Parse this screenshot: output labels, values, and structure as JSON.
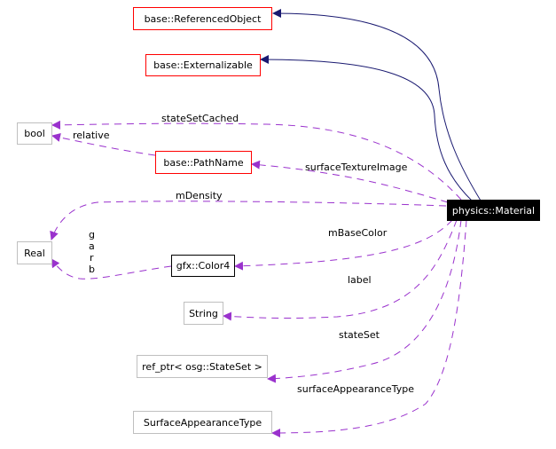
{
  "diagram": {
    "focus_class": "physics::Material",
    "nodes": [
      {
        "id": "referenced-object",
        "label": "base::ReferencedObject",
        "style": "red"
      },
      {
        "id": "externalizable",
        "label": "base::Externalizable",
        "style": "red"
      },
      {
        "id": "bool",
        "label": "bool",
        "style": "gray"
      },
      {
        "id": "pathname",
        "label": "base::PathName",
        "style": "red"
      },
      {
        "id": "material",
        "label": "physics::Material",
        "style": "focus"
      },
      {
        "id": "real",
        "label": "Real",
        "style": "gray"
      },
      {
        "id": "color4",
        "label": "gfx::Color4",
        "style": "black"
      },
      {
        "id": "string",
        "label": "String",
        "style": "gray"
      },
      {
        "id": "stateset-ptr",
        "label": "ref_ptr< osg::StateSet >",
        "style": "gray"
      },
      {
        "id": "surface-appearance-type",
        "label": "SurfaceAppearanceType",
        "style": "gray"
      }
    ],
    "edges": [
      {
        "from": "material",
        "to": "referenced-object",
        "kind": "inheritance",
        "label": ""
      },
      {
        "from": "material",
        "to": "externalizable",
        "kind": "inheritance",
        "label": ""
      },
      {
        "from": "material",
        "to": "bool",
        "kind": "usage",
        "label": "stateSetCached"
      },
      {
        "from": "pathname",
        "to": "bool",
        "kind": "usage",
        "label": "relative"
      },
      {
        "from": "material",
        "to": "pathname",
        "kind": "usage",
        "label": "surfaceTextureImage"
      },
      {
        "from": "material",
        "to": "real",
        "kind": "usage",
        "label": "mDensity"
      },
      {
        "from": "color4",
        "to": "real",
        "kind": "usage",
        "label": "g\na\nr\nb"
      },
      {
        "from": "material",
        "to": "color4",
        "kind": "usage",
        "label": "mBaseColor"
      },
      {
        "from": "material",
        "to": "string",
        "kind": "usage",
        "label": "label"
      },
      {
        "from": "material",
        "to": "stateset-ptr",
        "kind": "usage",
        "label": "stateSet"
      },
      {
        "from": "material",
        "to": "surface-appearance-type",
        "kind": "usage",
        "label": "surfaceAppearanceType"
      }
    ],
    "labels": {
      "stateSetCached": "stateSetCached",
      "relative": "relative",
      "surfaceTextureImage": "surfaceTextureImage",
      "mDensity": "mDensity",
      "g": "g",
      "a": "a",
      "r": "r",
      "b": "b",
      "mBaseColor": "mBaseColor",
      "label": "label",
      "stateSet": "stateSet",
      "surfaceAppearanceType": "surfaceAppearanceType"
    },
    "colors": {
      "inheritance": "#191970",
      "usage": "#9a32cd",
      "red_border": "#ff0000",
      "gray_border": "#bfbfbf"
    }
  }
}
